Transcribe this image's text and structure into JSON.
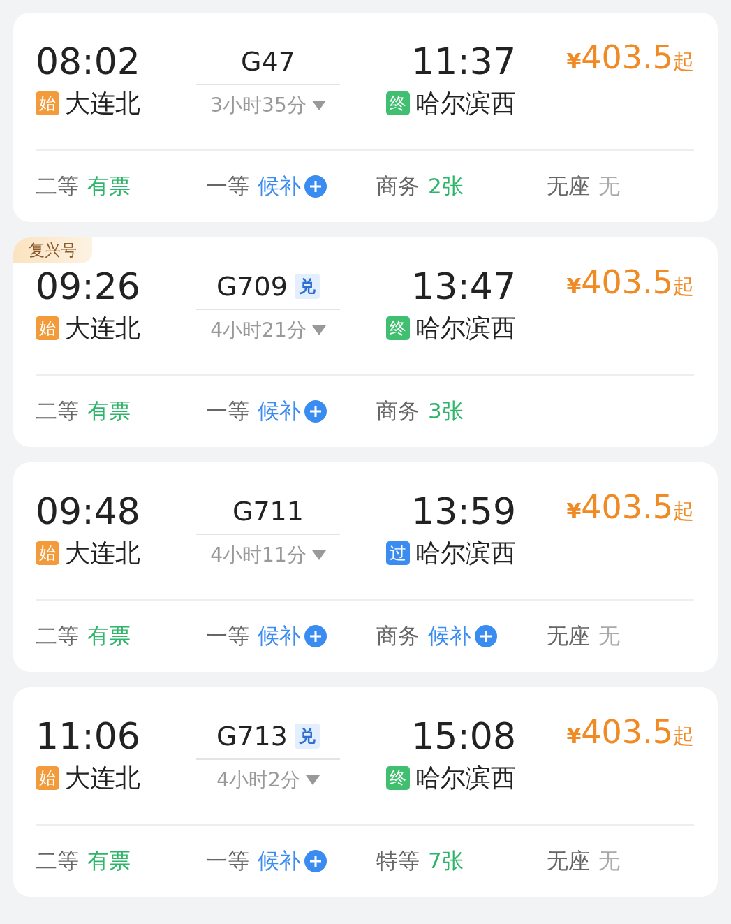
{
  "trains": [
    {
      "depart_time": "08:02",
      "depart_tag": {
        "text": "始",
        "kind": "origin"
      },
      "depart_station": "大连北",
      "train_no": "G47",
      "duration": "3小时35分",
      "arrive_time": "11:37",
      "arrive_tag": {
        "text": "终",
        "kind": "terminal"
      },
      "arrive_station": "哈尔滨西",
      "price": {
        "currency": "¥",
        "amount": "403.5",
        "suffix": "起"
      },
      "seats": [
        {
          "class": "二等",
          "status": "有票",
          "kind": "available"
        },
        {
          "class": "一等",
          "status": "候补",
          "kind": "waitlist"
        },
        {
          "class": "商务",
          "status": "2张",
          "kind": "available"
        },
        {
          "class": "无座",
          "status": "无",
          "kind": "none"
        }
      ]
    },
    {
      "badge": "复兴号",
      "depart_time": "09:26",
      "depart_tag": {
        "text": "始",
        "kind": "origin"
      },
      "depart_station": "大连北",
      "train_no": "G709",
      "train_tag": "兑",
      "duration": "4小时21分",
      "arrive_time": "13:47",
      "arrive_tag": {
        "text": "终",
        "kind": "terminal"
      },
      "arrive_station": "哈尔滨西",
      "price": {
        "currency": "¥",
        "amount": "403.5",
        "suffix": "起"
      },
      "seats": [
        {
          "class": "二等",
          "status": "有票",
          "kind": "available"
        },
        {
          "class": "一等",
          "status": "候补",
          "kind": "waitlist"
        },
        {
          "class": "商务",
          "status": "3张",
          "kind": "available"
        }
      ]
    },
    {
      "depart_time": "09:48",
      "depart_tag": {
        "text": "始",
        "kind": "origin"
      },
      "depart_station": "大连北",
      "train_no": "G711",
      "duration": "4小时11分",
      "arrive_time": "13:59",
      "arrive_tag": {
        "text": "过",
        "kind": "passing"
      },
      "arrive_station": "哈尔滨西",
      "price": {
        "currency": "¥",
        "amount": "403.5",
        "suffix": "起"
      },
      "seats": [
        {
          "class": "二等",
          "status": "有票",
          "kind": "available"
        },
        {
          "class": "一等",
          "status": "候补",
          "kind": "waitlist"
        },
        {
          "class": "商务",
          "status": "候补",
          "kind": "waitlist"
        },
        {
          "class": "无座",
          "status": "无",
          "kind": "none"
        }
      ]
    },
    {
      "depart_time": "11:06",
      "depart_tag": {
        "text": "始",
        "kind": "origin"
      },
      "depart_station": "大连北",
      "train_no": "G713",
      "train_tag": "兑",
      "duration": "4小时2分",
      "arrive_time": "15:08",
      "arrive_tag": {
        "text": "终",
        "kind": "terminal"
      },
      "arrive_station": "哈尔滨西",
      "price": {
        "currency": "¥",
        "amount": "403.5",
        "suffix": "起"
      },
      "seats": [
        {
          "class": "二等",
          "status": "有票",
          "kind": "available"
        },
        {
          "class": "一等",
          "status": "候补",
          "kind": "waitlist"
        },
        {
          "class": "特等",
          "status": "7张",
          "kind": "available"
        },
        {
          "class": "无座",
          "status": "无",
          "kind": "none"
        }
      ]
    }
  ]
}
